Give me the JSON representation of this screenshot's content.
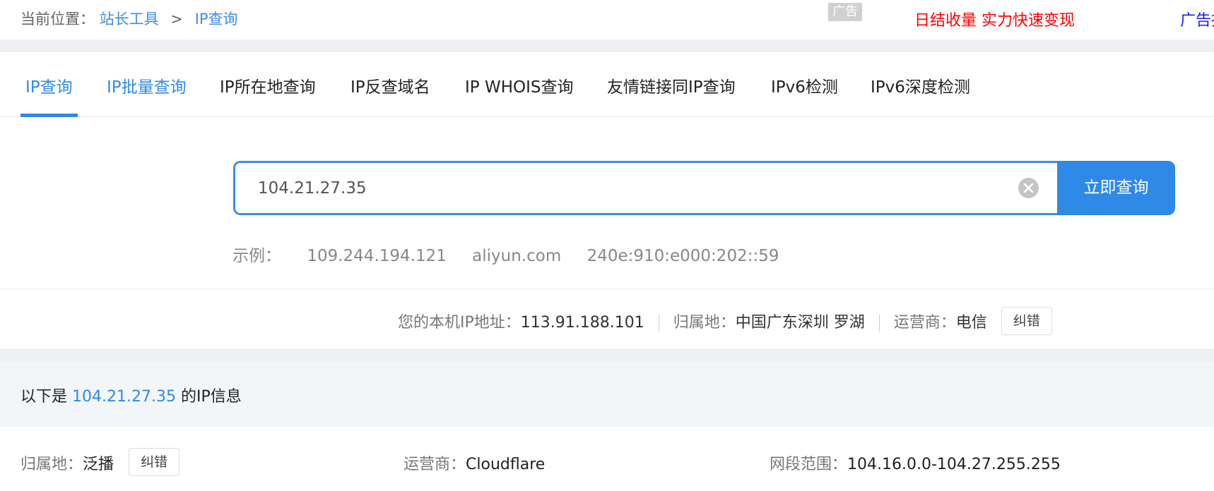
{
  "breadcrumb": {
    "prefix": "当前位置：",
    "items": [
      "站长工具",
      "IP查询"
    ],
    "separator": ">"
  },
  "ad": {
    "tag": "广告",
    "text": "日结收量 实力快速变现",
    "right_text": "广告投"
  },
  "tabs": [
    {
      "label": "IP查询",
      "active": true
    },
    {
      "label": "IP批量查询"
    },
    {
      "label": "IP所在地查询"
    },
    {
      "label": "IP反查域名"
    },
    {
      "label": "IP WHOIS查询"
    },
    {
      "label": "友情链接同IP查询"
    },
    {
      "label": "IPv6检测"
    },
    {
      "label": "IPv6深度检测"
    }
  ],
  "search": {
    "value": "104.21.27.35",
    "button_label": "立即查询"
  },
  "examples": {
    "label": "示例：",
    "items": [
      "109.244.194.121",
      "aliyun.com",
      "240e:910:e000:202::59"
    ]
  },
  "my_ip": {
    "ip_label": "您的本机IP地址：",
    "ip_value": "113.91.188.101",
    "location_label": "归属地：",
    "location_value": "中国广东深圳 罗湖",
    "isp_label": "运营商：",
    "isp_value": "电信",
    "correct_button": "纠错"
  },
  "result": {
    "heading_prefix": "以下是",
    "heading_ip": "104.21.27.35",
    "heading_suffix": "的IP信息",
    "location_label": "归属地：",
    "location_value": "泛播",
    "correct_button": "纠错",
    "isp_label": "运营商：",
    "isp_value": "Cloudflare",
    "range_label": "网段范围：",
    "range_value": "104.16.0.0-104.27.255.255"
  },
  "colors": {
    "accent": "#2e8ae6",
    "ad_red": "#ff0000",
    "ad_blue": "#1a1aff"
  }
}
